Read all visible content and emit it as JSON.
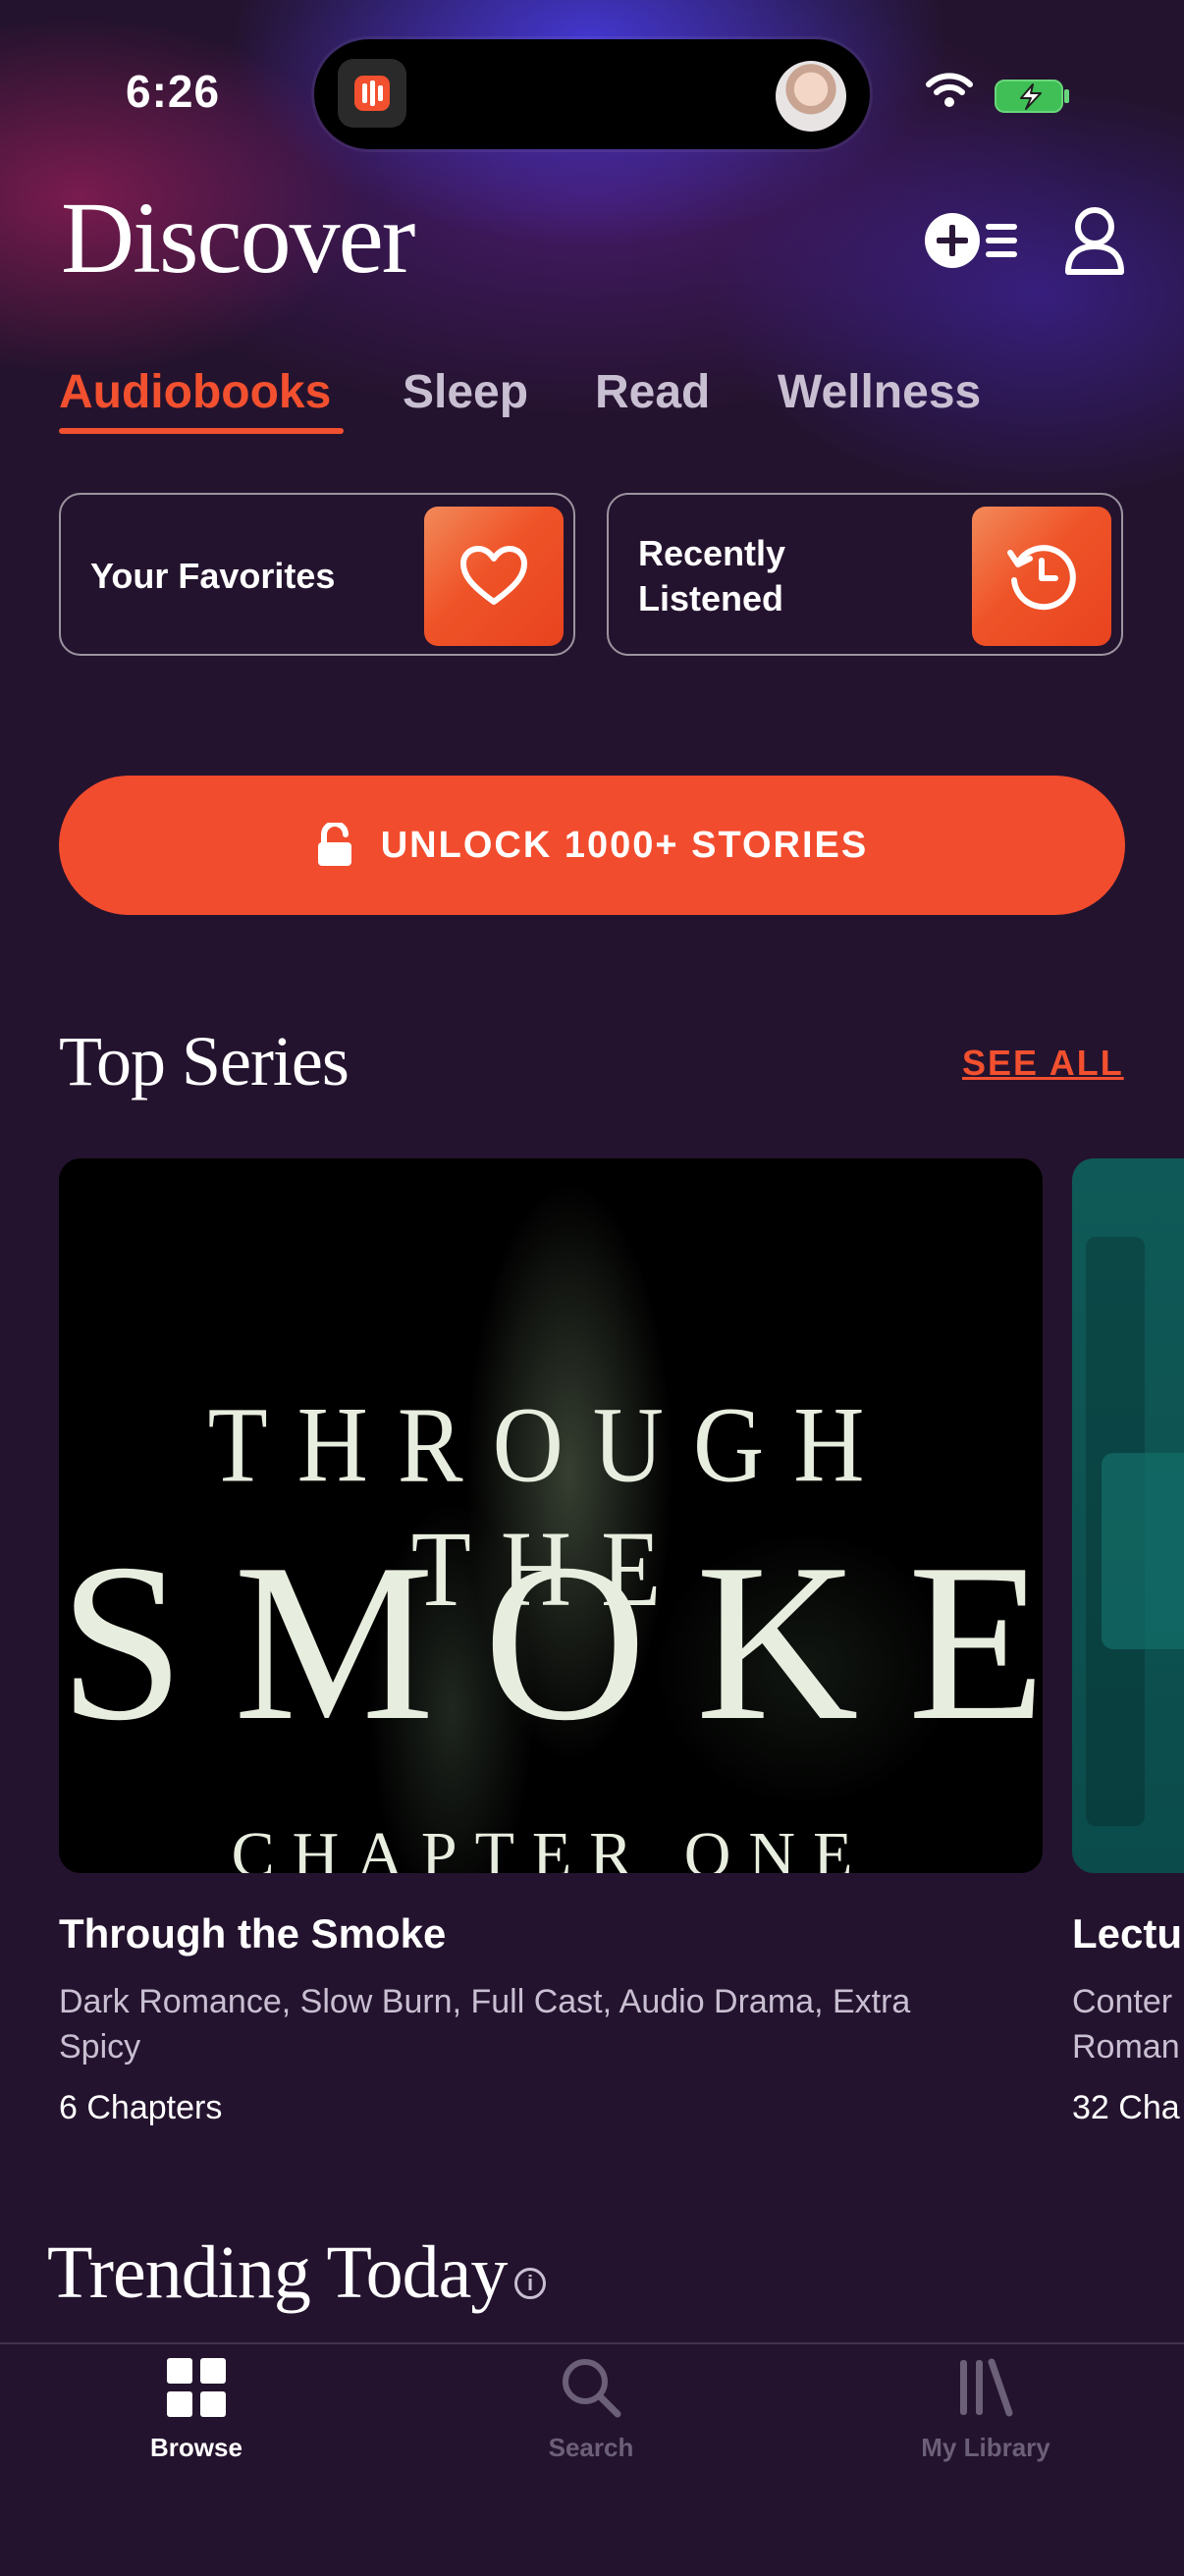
{
  "status": {
    "time": "6:26"
  },
  "header": {
    "title": "Discover",
    "add_queue_icon": "add-queue-icon",
    "profile_icon": "person-icon"
  },
  "tabs": [
    {
      "label": "Audiobooks",
      "active": true
    },
    {
      "label": "Sleep",
      "active": false
    },
    {
      "label": "Read",
      "active": false
    },
    {
      "label": "Wellness",
      "active": false
    }
  ],
  "quick_links": [
    {
      "label": "Your Favorites",
      "icon": "heart-icon"
    },
    {
      "label": "Recently Listened",
      "line1": "Recently",
      "line2": "Listened",
      "icon": "history-icon"
    }
  ],
  "unlock": {
    "label": "UNLOCK 1000+ STORIES",
    "icon": "unlock-icon"
  },
  "top_series": {
    "title": "Top Series",
    "see_all": "SEE ALL",
    "items": [
      {
        "cover_line1": "THROUGH THE",
        "cover_line2": "SMOKE",
        "cover_line3": "CHAPTER ONE",
        "title": "Through the Smoke",
        "tags_line1": "Dark Romance, Slow Burn, Full Cast, Audio Drama, Extra",
        "tags_line2": "Spicy",
        "meta": "6 Chapters"
      },
      {
        "title": "Lectu",
        "tags_line1": "Conter",
        "tags_line2": "Roman",
        "meta": "32 Cha"
      }
    ]
  },
  "trending": {
    "title": "Trending Today",
    "info_icon": "info-icon"
  },
  "nav": [
    {
      "label": "Browse",
      "icon": "grid-icon",
      "active": true
    },
    {
      "label": "Search",
      "icon": "search-icon",
      "active": false
    },
    {
      "label": "My Library",
      "icon": "library-icon",
      "active": false
    }
  ],
  "colors": {
    "accent": "#f24c2e",
    "background": "#24132e",
    "inactive": "#6c5f78"
  }
}
